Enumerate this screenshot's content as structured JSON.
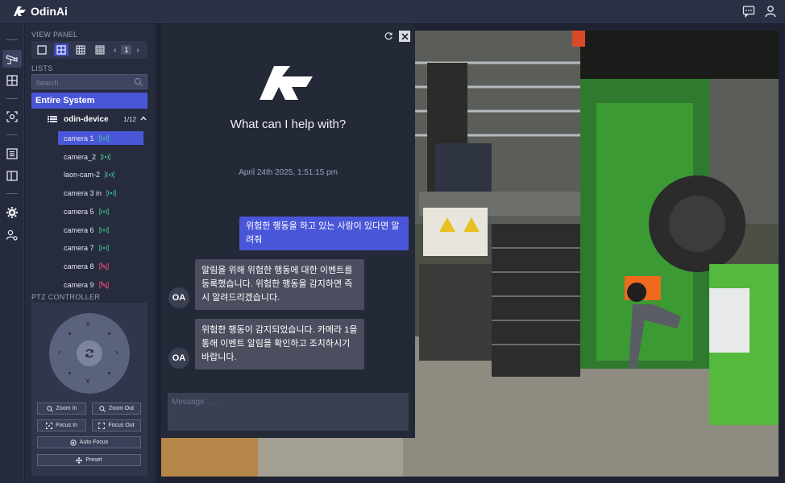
{
  "app": {
    "title": "OdinAi"
  },
  "header": {
    "chat_icon": "chat-bubble-icon",
    "user_icon": "user-icon"
  },
  "view_panel": {
    "title": "VIEW PANEL",
    "page": "1"
  },
  "lists": {
    "title": "LISTS",
    "search_placeholder": "Search",
    "entire_system": "Entire System",
    "device": {
      "name": "odin-device",
      "count": "1/12"
    },
    "cameras": [
      {
        "label": "camera 1",
        "status": "online"
      },
      {
        "label": "camera_2",
        "status": "online"
      },
      {
        "label": "laon-cam-2",
        "status": "online"
      },
      {
        "label": "camera 3 in",
        "status": "online"
      },
      {
        "label": "camera 5",
        "status": "online"
      },
      {
        "label": "camera 6",
        "status": "online"
      },
      {
        "label": "camera 7",
        "status": "online"
      },
      {
        "label": "camera 8",
        "status": "offline"
      },
      {
        "label": "camera 9",
        "status": "offline"
      }
    ]
  },
  "ptz": {
    "title": "PTZ CONTROLLER",
    "zoom_in": "Zoom In",
    "zoom_out": "Zoom Out",
    "focus_in": "Focus In",
    "focus_out": "Focus Out",
    "auto_focus": "Auto Focus",
    "preset": "Preset"
  },
  "chat": {
    "title": "What can I help with?",
    "date": "April 24th 2025, 1:51:15 pm",
    "avatar": "OA",
    "user_message": "위험한 행동을 하고 있는 사람이 있다면 알려줘",
    "bot_message_1": "알림을 위해 위험한 행동에 대한 이벤트를 등록했습니다. 위험한 행동을 감지하면 즉시 알려드리겠습니다.",
    "bot_message_2": "위험한 행동이 감지되었습니다. 카메라 1을 통해 이벤트 알림을 확인하고 조치하시기 바랍니다.",
    "input_placeholder": "Message. . . ."
  },
  "colors": {
    "accent": "#4a56d8",
    "online": "#3ec28f",
    "offline": "#e0457a",
    "panel": "#262b3d"
  }
}
